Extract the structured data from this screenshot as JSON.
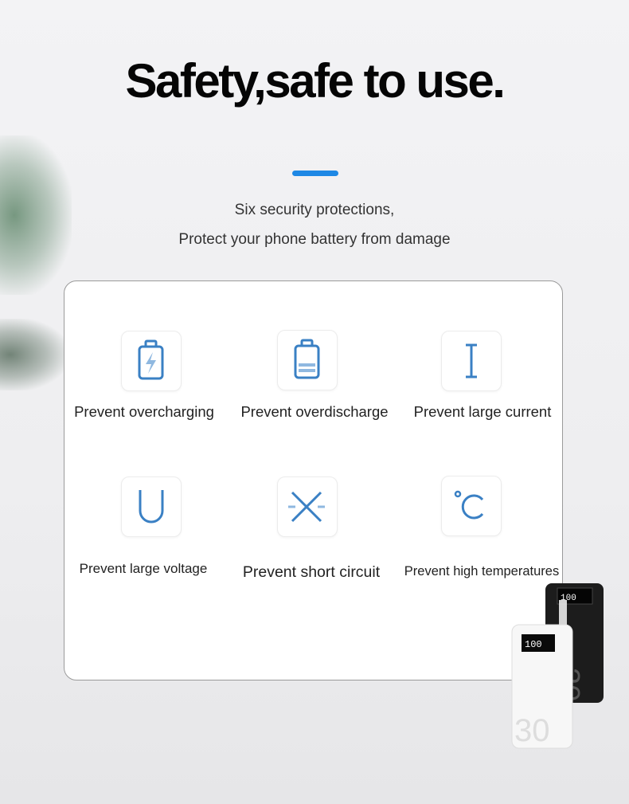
{
  "header": {
    "title": "Safety,safe to use.",
    "subtitle_line1": "Six security protections,",
    "subtitle_line2": "Protect your phone battery from damage"
  },
  "colors": {
    "accent": "#1e88e5",
    "icon": "#3a80c4"
  },
  "features": [
    {
      "label": "Prevent overcharging",
      "icon": "battery-charging-icon"
    },
    {
      "label": "Prevent overdischarge",
      "icon": "battery-low-icon"
    },
    {
      "label": "Prevent large current",
      "icon": "current-i-icon"
    },
    {
      "label": "Prevent large voltage",
      "icon": "voltage-u-icon"
    },
    {
      "label": "Prevent short circuit",
      "icon": "short-circuit-x-icon"
    },
    {
      "label": "Prevent high temperatures",
      "icon": "celsius-icon"
    }
  ],
  "product": {
    "display_text": "100",
    "capacity_mark": "30"
  }
}
